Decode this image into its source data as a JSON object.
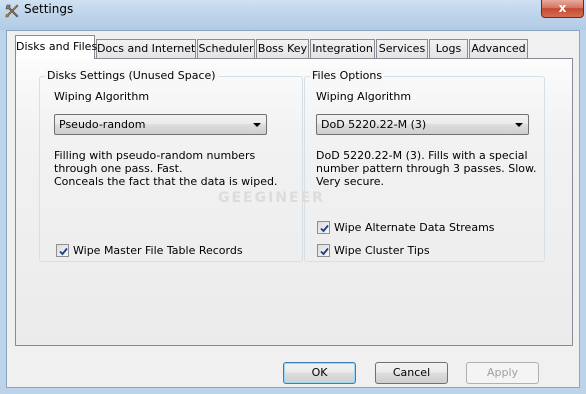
{
  "window": {
    "title": "Settings",
    "icon": "tools-icon",
    "close_glyph": "x"
  },
  "tabs": [
    {
      "label": "Disks and Files",
      "active": true
    },
    {
      "label": "Docs and Internet",
      "active": false
    },
    {
      "label": "Scheduler",
      "active": false
    },
    {
      "label": "Boss Key",
      "active": false
    },
    {
      "label": "Integration",
      "active": false
    },
    {
      "label": "Services",
      "active": false
    },
    {
      "label": "Logs",
      "active": false
    },
    {
      "label": "Advanced",
      "active": false
    }
  ],
  "disks": {
    "group_title": "Disks Settings (Unused Space)",
    "algo_label": "Wiping Algorithm",
    "algo_value": "Pseudo-random",
    "description": [
      "Filling with pseudo-random numbers",
      "through one pass. Fast.",
      "Conceals the fact that the data is wiped."
    ],
    "wipe_mft": {
      "label": "Wipe Master File Table Records",
      "checked": true
    }
  },
  "files": {
    "group_title": "Files Options",
    "algo_label": "Wiping Algorithm",
    "algo_value": "DoD 5220.22-M (3)",
    "description": [
      "DoD 5220.22-M (3). Fills with a special",
      "number pattern through 3 passes. Slow.",
      "Very secure."
    ],
    "wipe_ads": {
      "label": "Wipe Alternate Data Streams",
      "checked": true
    },
    "wipe_tips": {
      "label": "Wipe Cluster Tips",
      "checked": true
    }
  },
  "buttons": {
    "ok": "OK",
    "cancel": "Cancel",
    "apply": "Apply"
  },
  "watermark": "GEEGINEER",
  "colors": {
    "titlebar": "#bcd3ea",
    "close": "#c24a32",
    "default_button": "#3c7fb1"
  }
}
